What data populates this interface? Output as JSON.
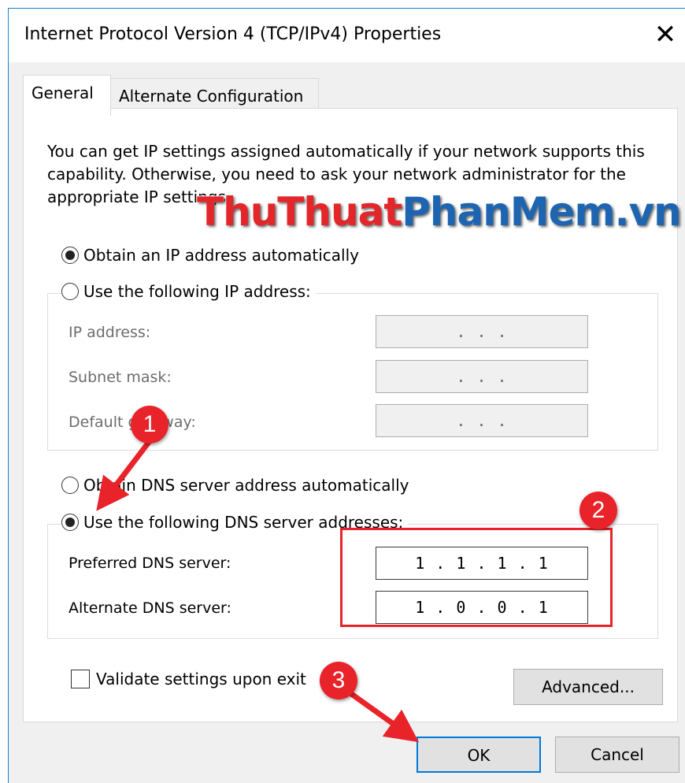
{
  "window": {
    "title": "Internet Protocol Version 4 (TCP/IPv4) Properties",
    "close_icon": "close-icon",
    "accent_color": "#1883d7"
  },
  "tabs": [
    {
      "label": "General",
      "selected": true
    },
    {
      "label": "Alternate Configuration",
      "selected": false
    }
  ],
  "intro_text": "You can get IP settings assigned automatically if your network supports this capability. Otherwise, you need to ask your network administrator for the appropriate IP settings.",
  "ip_section": {
    "auto_option": {
      "label": "Obtain an IP address automatically",
      "selected": true
    },
    "manual_option": {
      "label": "Use the following IP address:",
      "selected": false
    },
    "fields": [
      {
        "label": "IP address:",
        "value": ". . ."
      },
      {
        "label": "Subnet mask:",
        "value": ". . ."
      },
      {
        "label": "Default gateway:",
        "value": ". . ."
      }
    ]
  },
  "dns_section": {
    "auto_option": {
      "label": "Obtain DNS server address automatically",
      "selected": false
    },
    "manual_option": {
      "label": "Use the following DNS server addresses:",
      "selected": true
    },
    "fields": [
      {
        "label": "Preferred DNS server:",
        "value": "1 . 1 . 1 . 1"
      },
      {
        "label": "Alternate DNS server:",
        "value": "1 . 0 . 0 . 1"
      }
    ]
  },
  "validate_checkbox": {
    "label": "Validate settings upon exit",
    "checked": false
  },
  "buttons": {
    "advanced": "Advanced...",
    "ok": "OK",
    "cancel": "Cancel"
  },
  "watermark": {
    "part1": "ThuThuat",
    "part2": "PhanMem.vn"
  },
  "annotations": {
    "badge_1": "1",
    "badge_2": "2",
    "badge_3": "3",
    "annotation_color": "#e8232a"
  }
}
